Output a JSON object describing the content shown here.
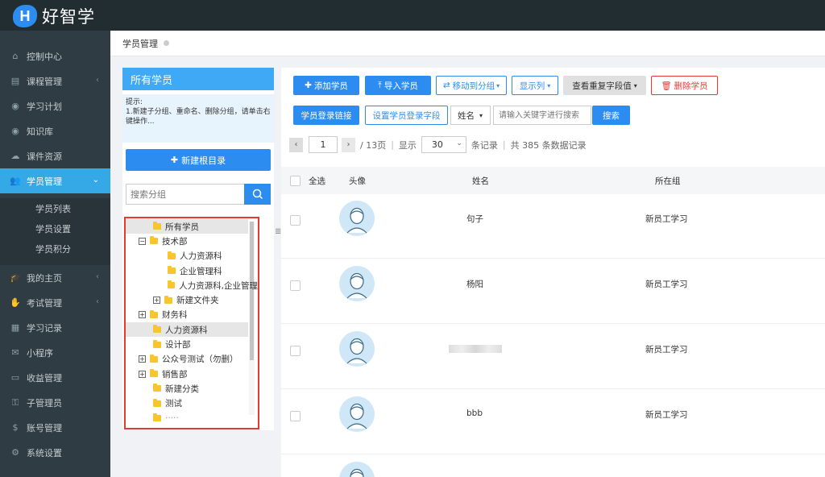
{
  "app": {
    "logo_letter": "H",
    "logo_text": "好智学"
  },
  "sidebar": {
    "items": [
      {
        "label": "控制中心",
        "icon": "home-icon",
        "chevron": ""
      },
      {
        "label": "课程管理",
        "icon": "book-icon",
        "chevron": "‹"
      },
      {
        "label": "学习计划",
        "icon": "eye-icon",
        "chevron": ""
      },
      {
        "label": "知识库",
        "icon": "eye-icon",
        "chevron": ""
      },
      {
        "label": "课件资源",
        "icon": "cloud-icon",
        "chevron": ""
      },
      {
        "label": "学员管理",
        "icon": "users-icon",
        "chevron": "⌄"
      },
      {
        "label": "我的主页",
        "icon": "graduation-cap-icon",
        "chevron": "‹"
      },
      {
        "label": "考试管理",
        "icon": "thumbs-up-icon",
        "chevron": "‹"
      },
      {
        "label": "学习记录",
        "icon": "book-open-icon",
        "chevron": ""
      },
      {
        "label": "小程序",
        "icon": "wechat-icon",
        "chevron": ""
      },
      {
        "label": "收益管理",
        "icon": "credit-card-icon",
        "chevron": ""
      },
      {
        "label": "子管理员",
        "icon": "user-lock-icon",
        "chevron": ""
      },
      {
        "label": "账号管理",
        "icon": "dollar-icon",
        "chevron": ""
      },
      {
        "label": "系统设置",
        "icon": "gear-icon",
        "chevron": ""
      }
    ],
    "sub_items": [
      "学员列表",
      "学员设置",
      "学员积分"
    ]
  },
  "breadcrumb": {
    "label": "学员管理"
  },
  "left_panel": {
    "title": "所有学员",
    "tip_line1": "提示:",
    "tip_line2": "1.新建子分组、重命名、删除分组，请单击右键操作...",
    "new_root_label": "新建根目录",
    "search_placeholder": "搜索分组",
    "tree": [
      {
        "label": "所有学员",
        "toggle": "",
        "highlight": true
      },
      {
        "label": "技术部",
        "toggle": "−",
        "highlight": false
      },
      {
        "label": "人力资源科",
        "toggle": "",
        "highlight": false
      },
      {
        "label": "企业管理科",
        "toggle": "",
        "highlight": false
      },
      {
        "label": "人力资源科,企业管理",
        "toggle": "",
        "highlight": false
      },
      {
        "label": "新建文件夹",
        "toggle": "+",
        "highlight": false
      },
      {
        "label": "财务科",
        "toggle": "+",
        "highlight": false
      },
      {
        "label": "人力资源科",
        "toggle": "",
        "highlight": true
      },
      {
        "label": "设计部",
        "toggle": "",
        "highlight": false
      },
      {
        "label": "公众号测试（勿删）",
        "toggle": "+",
        "highlight": false
      },
      {
        "label": "销售部",
        "toggle": "+",
        "highlight": false
      },
      {
        "label": "新建分类",
        "toggle": "",
        "highlight": false
      },
      {
        "label": "测试",
        "toggle": "",
        "highlight": false
      },
      {
        "label": "·····",
        "toggle": "",
        "highlight": false
      }
    ]
  },
  "toolbar": {
    "add_student": "添加学员",
    "import_student": "导入学员",
    "move_group": "移动到分组",
    "show_columns": "显示列",
    "check_duplicates": "查看重复字段值",
    "delete_student": "删除学员",
    "login_link": "学员登录链接",
    "login_fields": "设置学员登录字段",
    "field_select": "姓名",
    "keyword_placeholder": "请输入关键字进行搜索",
    "search": "搜索"
  },
  "pagination": {
    "current_page": "1",
    "total_pages": "/ 13页",
    "sep1": "|",
    "display_label": "显示",
    "page_size": "30",
    "records_label": "条记录",
    "sep2": "|",
    "total_records": "共 385 条数据记录"
  },
  "table": {
    "headers": {
      "select_all": "全选",
      "avatar": "头像",
      "name": "姓名",
      "group": "所在组"
    },
    "rows": [
      {
        "name": "句子",
        "group": "新员工学习"
      },
      {
        "name": "杨阳",
        "group": "新员工学习"
      },
      {
        "name": "",
        "group": "新员工学习"
      },
      {
        "name": "bbb",
        "group": "新员工学习"
      },
      {
        "name": "",
        "group": ""
      }
    ]
  },
  "colors": {
    "primary": "#2d8cf0",
    "sidebar_bg": "#2f3c43",
    "topbar_bg": "#222d32",
    "active_nav": "#35a9e6",
    "danger": "#e53935"
  }
}
